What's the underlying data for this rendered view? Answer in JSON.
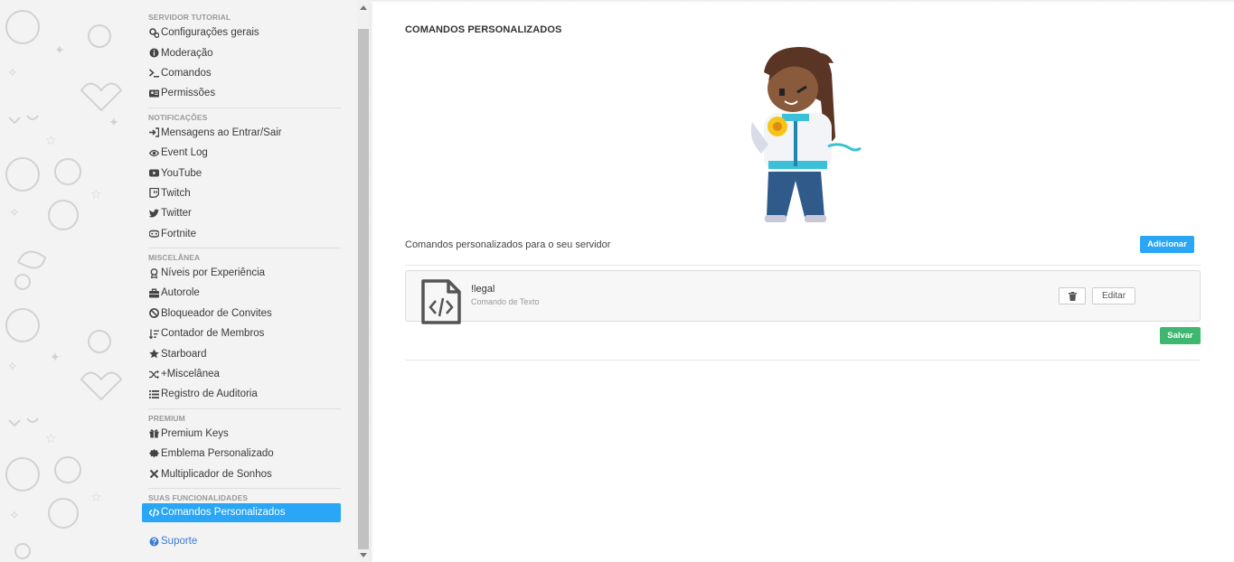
{
  "sidebar": {
    "sections": [
      {
        "title": "SERVIDOR TUTORIAL",
        "items": [
          {
            "label": "Configurações gerais",
            "icon": "gears-icon"
          },
          {
            "label": "Moderação",
            "icon": "info-icon"
          },
          {
            "label": "Comandos",
            "icon": "terminal-icon"
          },
          {
            "label": "Permissões",
            "icon": "id-card-icon"
          }
        ]
      },
      {
        "title": "NOTIFICAÇÕES",
        "items": [
          {
            "label": "Mensagens ao Entrar/Sair",
            "icon": "sign-in-icon"
          },
          {
            "label": "Event Log",
            "icon": "eye-icon"
          },
          {
            "label": "YouTube",
            "icon": "youtube-icon"
          },
          {
            "label": "Twitch",
            "icon": "twitch-icon"
          },
          {
            "label": "Twitter",
            "icon": "twitter-icon"
          },
          {
            "label": "Fortnite",
            "icon": "gamepad-icon"
          }
        ]
      },
      {
        "title": "MISCELÂNEA",
        "items": [
          {
            "label": "Níveis por Experiência",
            "icon": "ribbon-icon"
          },
          {
            "label": "Autorole",
            "icon": "briefcase-icon"
          },
          {
            "label": "Bloqueador de Convites",
            "icon": "ban-icon"
          },
          {
            "label": "Contador de Membros",
            "icon": "sort-numeric-icon"
          },
          {
            "label": "Starboard",
            "icon": "star-icon"
          },
          {
            "label": "+Miscelânea",
            "icon": "random-icon"
          },
          {
            "label": "Registro de Auditoria",
            "icon": "list-icon"
          }
        ]
      },
      {
        "title": "PREMIUM",
        "items": [
          {
            "label": "Premium Keys",
            "icon": "gift-icon"
          },
          {
            "label": "Emblema Personalizado",
            "icon": "certificate-icon"
          },
          {
            "label": "Multiplicador de Sonhos",
            "icon": "times-icon"
          }
        ]
      },
      {
        "title": "SUAS FUNCIONALIDADES",
        "items": [
          {
            "label": "Comandos Personalizados",
            "icon": "code-icon",
            "active": true
          }
        ]
      }
    ],
    "support": {
      "label": "Suporte",
      "icon": "question-circle-icon"
    },
    "active_color": "#29a6f5"
  },
  "main": {
    "title": "COMANDOS PERSONALIZADOS",
    "subtitle": "Comandos personalizados para o seu servidor",
    "add_label": "Adicionar",
    "commands": [
      {
        "name": "!legal",
        "type": "Comando de Texto",
        "icon": "file-code-icon"
      }
    ],
    "edit_label": "Editar",
    "delete_icon": "trash-icon",
    "save_label": "Salvar",
    "save_color": "#3fb770"
  }
}
